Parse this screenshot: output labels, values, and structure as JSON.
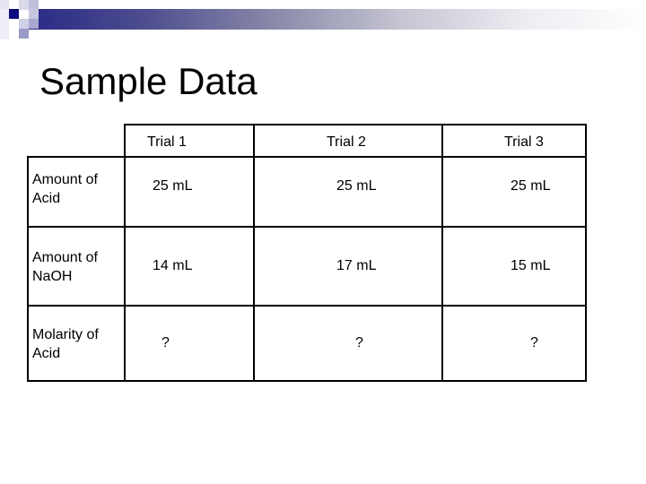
{
  "slide": {
    "title": "Sample Data"
  },
  "table": {
    "columns": [
      "",
      "Trial 1",
      "Trial 2",
      "Trial 3"
    ],
    "rows": [
      {
        "label_line1": "Amount of",
        "label_line2": "Acid",
        "values": [
          "25 mL",
          "25 mL",
          "25 mL"
        ]
      },
      {
        "label_line1": "Amount of",
        "label_line2": "NaOH",
        "values": [
          "14 mL",
          "17 mL",
          "15 mL"
        ]
      },
      {
        "label_line1": "Molarity of",
        "label_line2": "Acid",
        "values": [
          "?",
          "?",
          "?"
        ]
      }
    ]
  },
  "colors": {
    "banner_dark": "#2a2a86",
    "accent_square": "#0b0b80",
    "text": "#000000",
    "border": "#000000"
  }
}
